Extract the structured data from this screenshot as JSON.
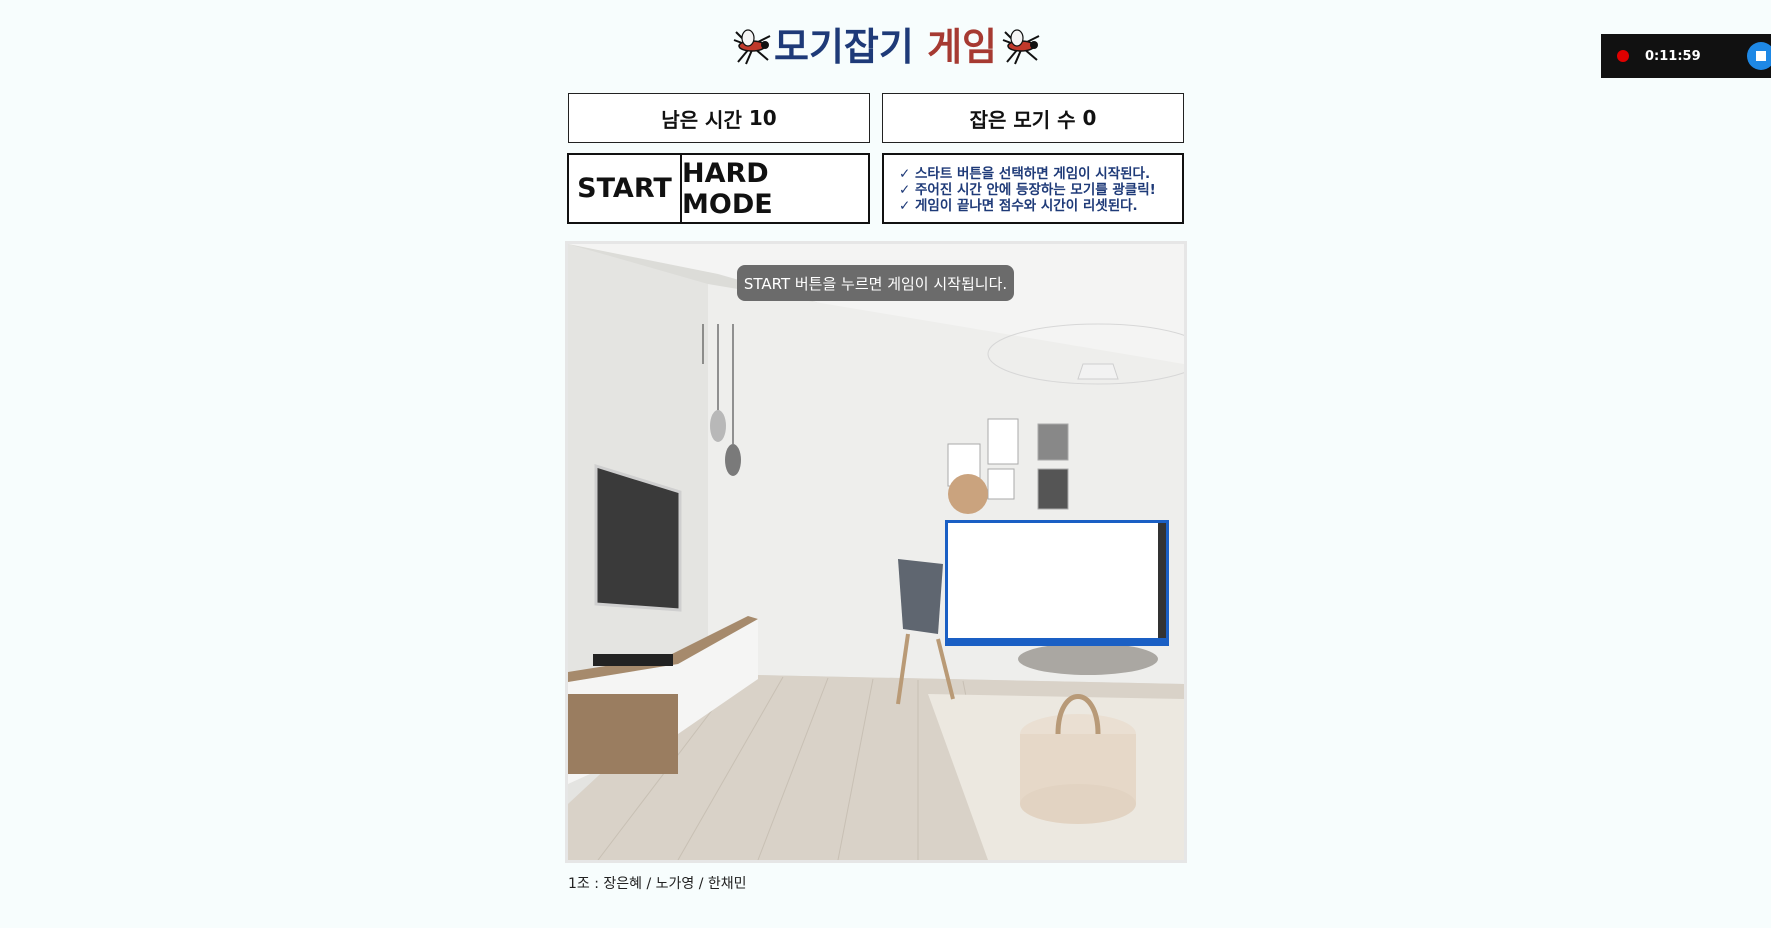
{
  "header": {
    "title_main": "모기잡기",
    "title_accent": "게임",
    "title_icon": "mosquito-icon"
  },
  "status": {
    "time_label": "남은 시간",
    "time_value": "10",
    "score_label": "잡은 모기 수",
    "score_value": "0"
  },
  "controls": {
    "start_label": "START",
    "hard_label": "HARD MODE"
  },
  "rules": [
    "✓ 스타트 버튼을 선택하면 게임이 시작된다.",
    "✓ 주어진 시간 안에 등장하는 모기를 광클릭!",
    "✓ 게임이 끝나면 점수와 시간이 리셋된다."
  ],
  "stage": {
    "message": "START 버튼을 누르면 게임이 시작됩니다."
  },
  "footer": {
    "credits": "1조 : 장은혜 / 노가영 / 한채민"
  },
  "recorder": {
    "elapsed": "0:11:59",
    "colors": {
      "record": "#e00000",
      "stop": "#1e88e5"
    }
  },
  "colors": {
    "title": "#1e3a78",
    "title_accent": "#a63a32",
    "background": "#f7fdfd"
  }
}
